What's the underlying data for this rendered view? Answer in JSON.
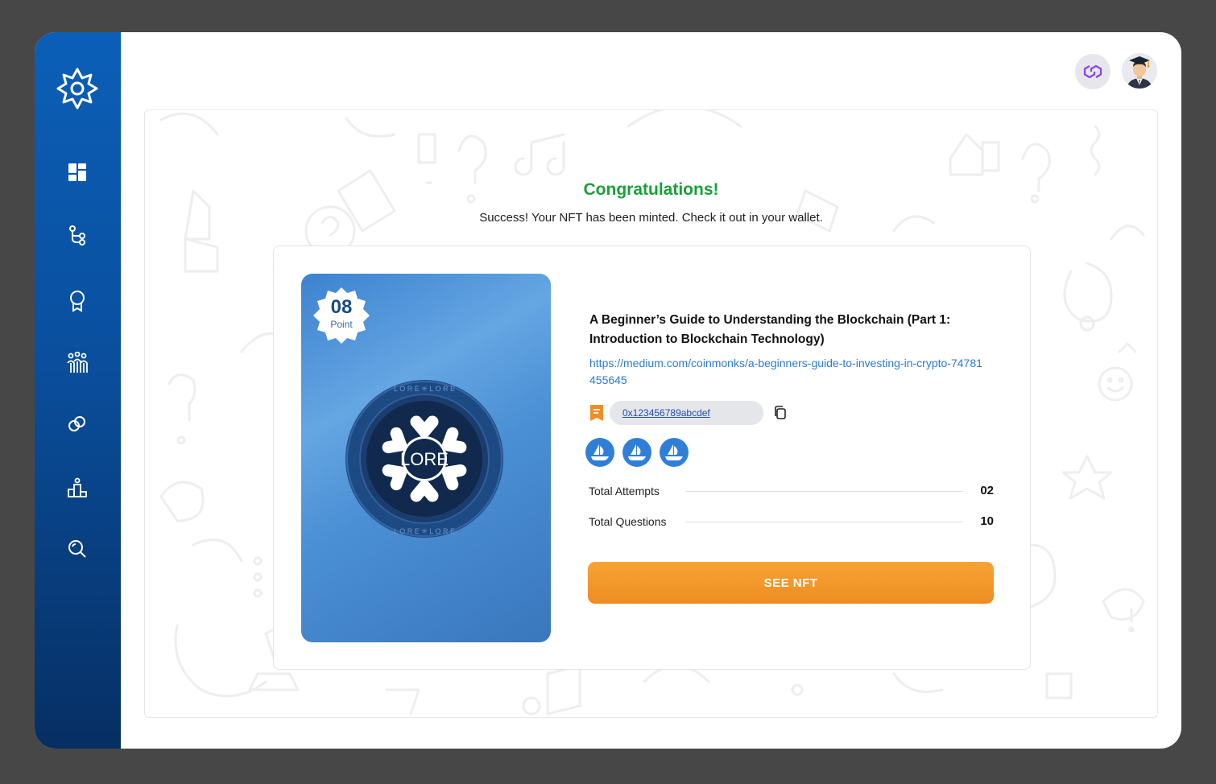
{
  "header": {
    "network_icon": "polygon-icon",
    "avatar_icon": "graduate-avatar"
  },
  "sidebar": {
    "logo": "lore-logo",
    "items": [
      {
        "icon": "dashboard-icon"
      },
      {
        "icon": "path-icon"
      },
      {
        "icon": "award-icon"
      },
      {
        "icon": "community-icon"
      },
      {
        "icon": "link-icon"
      },
      {
        "icon": "leaderboard-icon"
      },
      {
        "icon": "search-icon"
      }
    ]
  },
  "main": {
    "title": "Congratulations!",
    "subtitle": "Success! Your NFT has been minted. Check it out in your wallet.",
    "nft": {
      "points": "08",
      "points_label": "Point",
      "coin_text": "LORE"
    },
    "article_title": "A Beginner’s Guide to Understanding the Blockchain (Part 1: Introduction to Blockchain Technology)",
    "article_link": "https://medium.com/coinmonks/a-beginners-guide-to-investing-in-crypto-74781455645",
    "wallet_address": "0x123456789abcdef",
    "marketplace_icons": [
      "opensea-icon",
      "opensea-icon",
      "opensea-icon"
    ],
    "stats": [
      {
        "label": "Total Attempts",
        "value": "02"
      },
      {
        "label": "Total Questions",
        "value": "10"
      }
    ],
    "cta_label": "SEE NFT"
  },
  "colors": {
    "sidebar": "#0a4f9e",
    "success": "#19a03a",
    "accent": "#f39a2d",
    "link": "#2d7ad6"
  }
}
